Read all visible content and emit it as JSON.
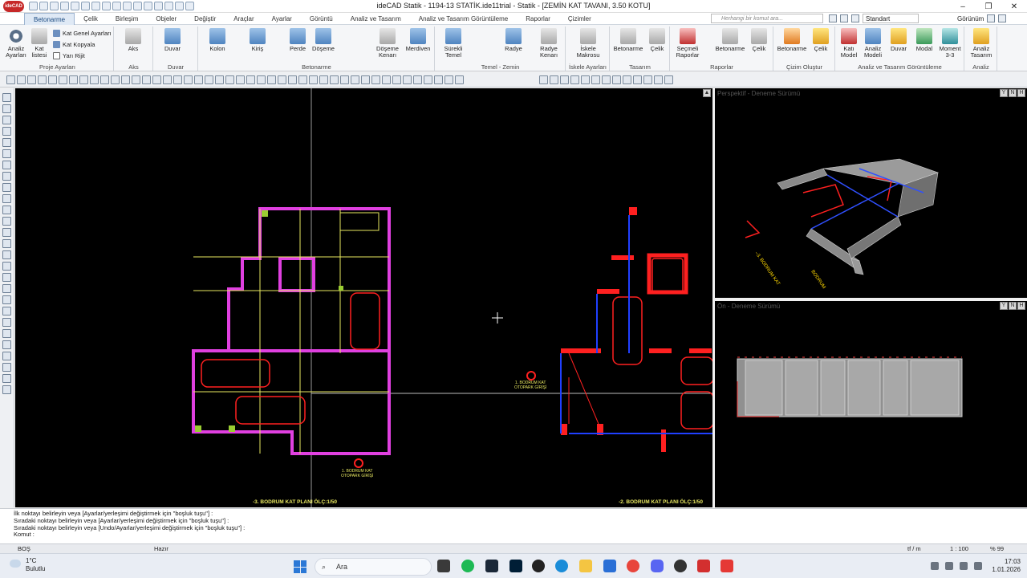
{
  "app": {
    "logo_text": "ideCAD",
    "window_title": "ideCAD Statik - 1194-13 STATİK.ide11trial - Statik - [ZEMİN KAT TAVANI,  3.50 KOTU]"
  },
  "menu": {
    "tabs": [
      "Betonarme",
      "Çelik",
      "Birleşim",
      "Objeler",
      "Değiştir",
      "Araçlar",
      "Ayarlar",
      "Görüntü",
      "Analiz ve Tasarım",
      "Analiz ve Tasarım Görüntüleme",
      "Raporlar",
      "Çizimler"
    ],
    "active_tab": "Betonarme",
    "search_placeholder": "Herhangi bir komut ara...",
    "style_select": "Standart",
    "view_label": "Görünüm"
  },
  "ribbon": {
    "groups": [
      {
        "label": "Proje Ayarları",
        "buttons": [
          "Analiz Ayarları",
          "Kat listesi"
        ],
        "small": [
          "Kat Genel Ayarları",
          "Kat Kopyala",
          "Yarı Rijit"
        ]
      },
      {
        "label": "Aks",
        "buttons": [
          "Aks"
        ]
      },
      {
        "label": "Duvar",
        "buttons": [
          "Duvar"
        ]
      },
      {
        "label": "Betonarme",
        "buttons": [
          "Kolon",
          "Kiriş",
          "Perde",
          "Döşeme",
          "Döşeme Kenarı",
          "Merdiven"
        ]
      },
      {
        "label": "Temel - Zemin",
        "buttons": [
          "Sürekli Temel",
          "Radye",
          "Radye Kenarı"
        ]
      },
      {
        "label": "İskele Ayarları",
        "buttons": [
          "İskele Makrosu"
        ]
      },
      {
        "label": "Tasarım",
        "buttons": [
          "Betonarme",
          "Çelik"
        ]
      },
      {
        "label": "Raporlar",
        "buttons": [
          "Seçmeli Raporlar",
          "Betonarme",
          "Çelik"
        ]
      },
      {
        "label": "Çizim Oluştur",
        "buttons": [
          "Betonarme",
          "Çelik"
        ]
      },
      {
        "label": "Analiz ve Tasarım Görüntüleme",
        "buttons": [
          "Katı Model",
          "Analiz Modeli",
          "Duvar",
          "Modal",
          "Moment 3-3"
        ]
      },
      {
        "label": "Analiz",
        "buttons": [
          "Analiz Tasarım"
        ]
      }
    ]
  },
  "views": {
    "perspective_label": "Perspektif - Deneme Sürümü",
    "front_label": "Ön - Deneme Sürümü",
    "view_controls": [
      "Y",
      "N",
      "H"
    ]
  },
  "drawing": {
    "plan_title_left": "-3. BODRUM KAT PLANI ÖLÇ:1/50",
    "plan_title_right": "-2. BODRUM KAT PLANI ÖLÇ:1/50",
    "entry_label_1": "1. BODRUM KAT",
    "entry_label_2": "OTOPARK GİRİŞİ",
    "colors": {
      "wall": "#e040e0",
      "car": "#ff2020",
      "axis": "#ffff40",
      "beam": "#2040ff",
      "column": "#ff3030"
    }
  },
  "command_lines": [
    "İlk noktayı belirleyin veya [Ayarlar/yerleşimi değiştirmek için \"boşluk tuşu\"] :",
    "Sıradaki noktayı belirleyin veya [Ayarlar/yerleşimi değiştirmek için \"boşluk tuşu\"] :",
    "Sıradaki noktayı belirleyin veya [Undo/Ayarlar/yerleşimi değiştirmek için \"boşluk tuşu\"] :",
    "Komut :"
  ],
  "status": {
    "left": "BOŞ",
    "middle": "Hazır",
    "units": "tf / m",
    "scale": "1 : 100",
    "zoom": "% 99"
  },
  "taskbar": {
    "weather_temp": "1°C",
    "weather_desc": "Bulutlu",
    "search_label": "Ara",
    "time": "17:03",
    "date": "1.01.2026"
  }
}
